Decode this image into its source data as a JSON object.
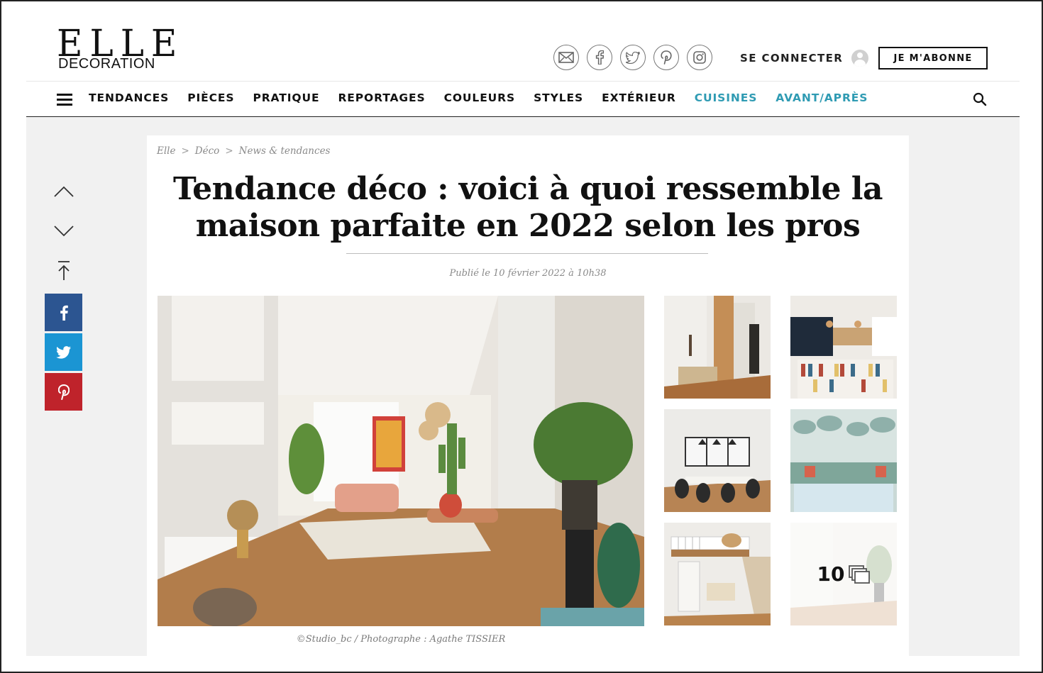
{
  "header": {
    "logo_main": "ELLE",
    "logo_sub": "DECORATION",
    "social_icons": [
      "email-icon",
      "facebook-icon",
      "twitter-icon",
      "pinterest-icon",
      "instagram-icon"
    ],
    "login_label": "SE CONNECTER",
    "subscribe_label": "JE M'ABONNE"
  },
  "nav": {
    "items": [
      {
        "label": "TENDANCES"
      },
      {
        "label": "PIÈCES"
      },
      {
        "label": "PRATIQUE"
      },
      {
        "label": "REPORTAGES"
      },
      {
        "label": "COULEURS"
      },
      {
        "label": "STYLES"
      },
      {
        "label": "EXTÉRIEUR"
      },
      {
        "label": "CUISINES"
      },
      {
        "label": "AVANT/APRÈS"
      }
    ],
    "accent_color": "#2f9bb3"
  },
  "breadcrumb": [
    "Elle",
    "Déco",
    "News & tendances"
  ],
  "article": {
    "title_line1": "Tendance déco : voici à quoi ressemble la",
    "title_line2": "maison parfaite en 2022 selon les pros",
    "published": "Publié le 10 février 2022 à 10h38",
    "credit": "©Studio_bc / Photographe : Agathe TISSIER",
    "more_photos_count": "10"
  },
  "share": {
    "facebook_color": "#2c5591",
    "twitter_color": "#1b95d3",
    "pinterest_color": "#bf232b"
  }
}
